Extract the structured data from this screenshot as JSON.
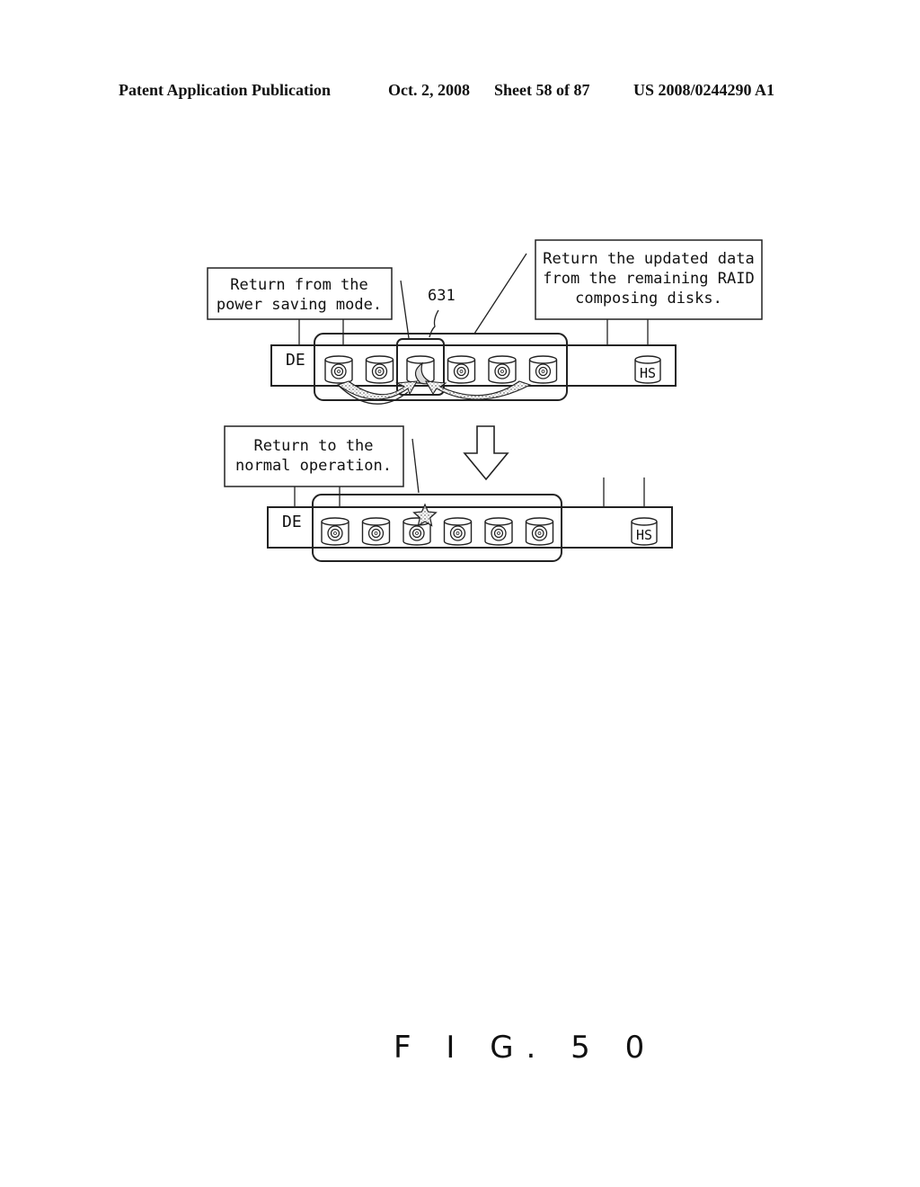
{
  "header": {
    "publication": "Patent Application Publication",
    "date": "Oct. 2, 2008",
    "sheet": "Sheet 58 of 87",
    "patent_number": "US 2008/0244290 A1"
  },
  "diagram": {
    "top": {
      "callout_left": [
        "Return from the",
        "power saving mode."
      ],
      "callout_right": [
        "Return the updated data",
        "from the remaining RAID",
        "composing disks."
      ],
      "reference_label": "631",
      "enclosure_label": "DE",
      "disks": [
        {
          "state": "active",
          "icon": "disk-icon"
        },
        {
          "state": "active",
          "icon": "disk-icon"
        },
        {
          "state": "power-saving",
          "icon": "moon-icon"
        },
        {
          "state": "active",
          "icon": "disk-icon"
        },
        {
          "state": "active",
          "icon": "disk-icon"
        },
        {
          "state": "active",
          "icon": "disk-icon"
        }
      ],
      "hot_spare_label": "HS"
    },
    "transition_arrow": "down-arrow-icon",
    "bottom": {
      "callout_left": [
        "Return to the",
        "normal operation."
      ],
      "enclosure_label": "DE",
      "disks": [
        {
          "state": "active",
          "icon": "disk-icon"
        },
        {
          "state": "active",
          "icon": "disk-icon"
        },
        {
          "state": "restored",
          "icon": "star-icon"
        },
        {
          "state": "active",
          "icon": "disk-icon"
        },
        {
          "state": "active",
          "icon": "disk-icon"
        },
        {
          "state": "active",
          "icon": "disk-icon"
        }
      ],
      "hot_spare_label": "HS"
    }
  },
  "figure_label": "F I G. 5 0"
}
